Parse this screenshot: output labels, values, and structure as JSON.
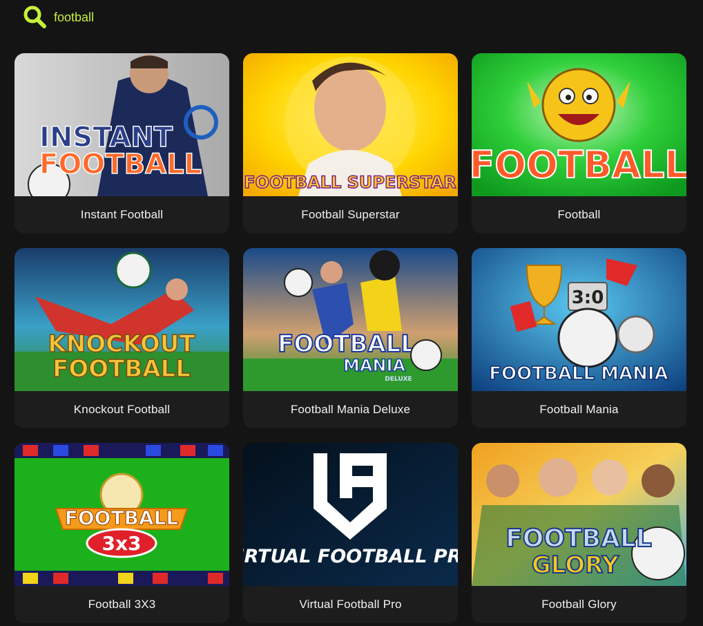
{
  "search": {
    "value": "football",
    "icon": "search-icon",
    "accent_color": "#c6f23a"
  },
  "games": [
    {
      "title": "Instant Football",
      "art_title": "INSTANT FOOTBALL"
    },
    {
      "title": "Football Superstar",
      "art_title": "FOOTBALL SUPERSTAR"
    },
    {
      "title": "Football",
      "art_title": "FOOTBALL"
    },
    {
      "title": "Knockout Football",
      "art_title": "KNOCKOUT FOOTBALL"
    },
    {
      "title": "Football Mania Deluxe",
      "art_title": "FOOTBALL MANIA",
      "art_subtitle": "DELUXE"
    },
    {
      "title": "Football Mania",
      "art_title": "FOOTBALL MANIA",
      "art_score": "3:0"
    },
    {
      "title": "Football 3X3",
      "art_title": "FOOTBALL",
      "art_subtitle": "3x3"
    },
    {
      "title": "Virtual Football Pro",
      "art_title": "VIRTUAL FOOTBALL PRO"
    },
    {
      "title": "Football Glory",
      "art_title": "FOOTBALL GLORY"
    }
  ]
}
